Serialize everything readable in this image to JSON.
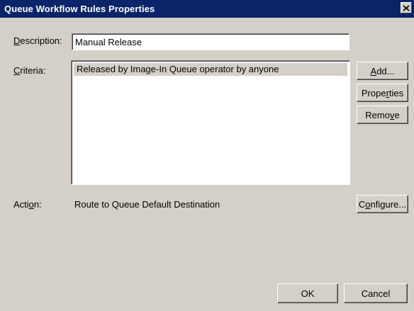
{
  "window": {
    "title": "Queue Workflow Rules Properties",
    "close_glyph": "✕"
  },
  "description": {
    "label_pre": "",
    "label_accel": "D",
    "label_post": "escription:",
    "value": "Manual Release"
  },
  "criteria": {
    "label_pre": "",
    "label_accel": "C",
    "label_post": "riteria:",
    "items": [
      "Released by Image-In Queue operator by anyone"
    ]
  },
  "buttons": {
    "add": {
      "pre": "",
      "accel": "A",
      "post": "dd..."
    },
    "properties": {
      "pre": "Prope",
      "accel": "r",
      "post": "ties"
    },
    "remove": {
      "pre": "Remo",
      "accel": "v",
      "post": "e"
    },
    "configure": {
      "pre": "C",
      "accel": "o",
      "post": "nfigure..."
    },
    "ok": "OK",
    "cancel": "Cancel"
  },
  "action": {
    "label_pre": "Acti",
    "label_accel": "o",
    "label_post": "n:",
    "value": "Route to Queue Default Destination"
  }
}
